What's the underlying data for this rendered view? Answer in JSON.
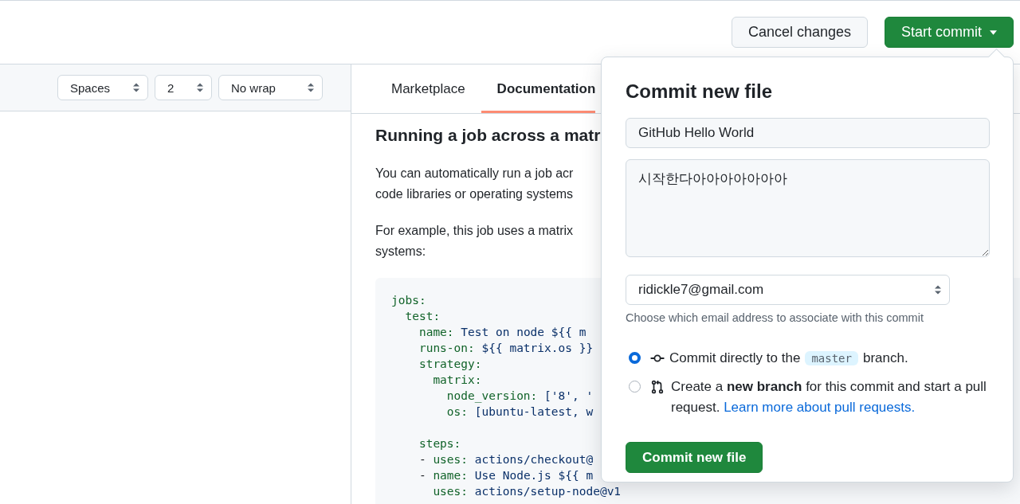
{
  "top_bar": {
    "buttons": [
      {
        "label": "Cancel changes",
        "kind": "secondary"
      },
      {
        "label": "Start commit",
        "kind": "primary"
      }
    ]
  },
  "editor_toolbar": {
    "selects": [
      {
        "value": "Spaces"
      },
      {
        "value": "2"
      },
      {
        "value": "No wrap"
      }
    ]
  },
  "docs": {
    "tabs": [
      {
        "label": "Marketplace",
        "selected": false
      },
      {
        "label": "Documentation",
        "selected": true
      }
    ],
    "heading": "Running a job across a matr",
    "paragraphs": [
      [
        "You can automatically run a job acr",
        "code libraries or operating systems"
      ],
      [
        "For example, this job uses a matrix",
        "systems:"
      ]
    ],
    "code_lines": [
      {
        "kind": "pair",
        "key": "jobs:"
      },
      {
        "kind": "pair",
        "key": "  test:"
      },
      {
        "kind": "pair",
        "key": "    name:",
        "value": " Test on node ${{ m"
      },
      {
        "kind": "pair",
        "key": "    runs-on:",
        "value": " ${{ matrix.os }}"
      },
      {
        "kind": "pair",
        "key": "    strategy:"
      },
      {
        "kind": "pair",
        "key": "      matrix:"
      },
      {
        "kind": "pair",
        "key": "        node_version:",
        "value": " ['8', '"
      },
      {
        "kind": "pair",
        "key": "        os:",
        "value": " [ubuntu-latest, w"
      },
      {
        "kind": "blank"
      },
      {
        "kind": "pair",
        "key": "    steps:"
      },
      {
        "kind": "pair",
        "prefix": "    - ",
        "key": "uses:",
        "value": " actions/checkout@"
      },
      {
        "kind": "pair",
        "prefix": "    - ",
        "key": "name:",
        "value": " Use Node.js ${{ m"
      },
      {
        "kind": "pair",
        "key": "      uses:",
        "value": " actions/setup-node@v1"
      }
    ]
  },
  "commit_dialog": {
    "title": "Commit new file",
    "summary_field": {
      "value": "GitHub Hello World"
    },
    "description_field": {
      "value": "시작한다아아아아아아아"
    },
    "email_select": {
      "value": "ridickle7@gmail.com"
    },
    "email_hint": "Choose which email address to associate with this commit",
    "options": [
      {
        "kind": "direct",
        "selected": true,
        "text_before": "Commit directly to the",
        "branch": "master",
        "text_after": "branch."
      },
      {
        "kind": "new_branch",
        "selected": false,
        "text": "Create a **new branch** for this commit and start a pull request.",
        "link": "Learn more about pull requests."
      }
    ],
    "submit_button": "Commit new file"
  }
}
